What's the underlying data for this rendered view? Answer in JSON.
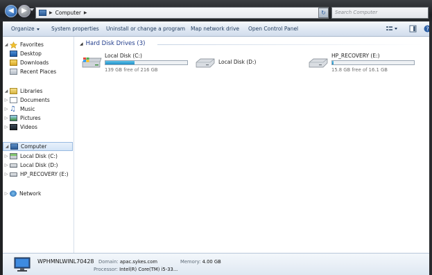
{
  "address": {
    "path": [
      "Computer"
    ]
  },
  "search": {
    "placeholder": "Search Computer"
  },
  "commands": {
    "organize": "Organize",
    "system_properties": "System properties",
    "uninstall": "Uninstall or change a program",
    "map_network": "Map network drive",
    "control_panel": "Open Control Panel"
  },
  "nav": {
    "favorites": {
      "label": "Favorites",
      "items": [
        "Desktop",
        "Downloads",
        "Recent Places"
      ]
    },
    "libraries": {
      "label": "Libraries",
      "items": [
        "Documents",
        "Music",
        "Pictures",
        "Videos"
      ]
    },
    "computer": {
      "label": "Computer",
      "items": [
        "Local Disk (C:)",
        "Local Disk (D:)",
        "HP_RECOVERY (E:)"
      ]
    },
    "network": {
      "label": "Network"
    }
  },
  "content": {
    "group_title": "Hard Disk Drives (3)",
    "drives": [
      {
        "name": "Local Disk (C:)",
        "free_text": "139 GB free of 216 GB",
        "used_fraction": 0.36,
        "show_bar": true
      },
      {
        "name": "Local Disk (D:)",
        "free_text": "",
        "used_fraction": 0,
        "show_bar": false
      },
      {
        "name": "HP_RECOVERY (E:)",
        "free_text": "15.8 GB free of 16.1 GB",
        "used_fraction": 0.02,
        "show_bar": true
      }
    ]
  },
  "details": {
    "computer_name": "WPHMNLWINL70428",
    "domain_label": "Domain:",
    "domain": "apac.sykes.com",
    "memory_label": "Memory:",
    "memory": "4.00 GB",
    "processor_label": "Processor:",
    "processor": "Intel(R) Core(TM) i5-33..."
  },
  "colors": {
    "selection": "#d3e4f7",
    "bar_fill": "#1f8fc8",
    "header_text": "#1e3a8a"
  }
}
